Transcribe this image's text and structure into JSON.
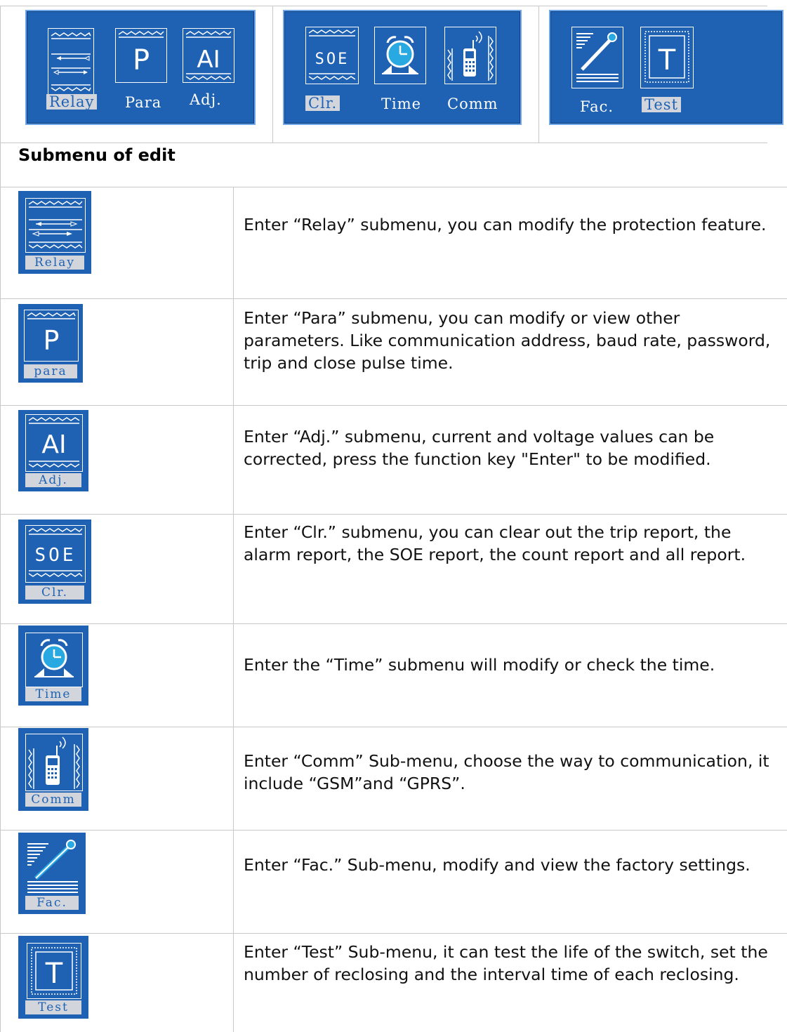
{
  "top_panels": [
    {
      "items": [
        {
          "label": "Relay",
          "selected": true
        },
        {
          "label": "Para",
          "selected": false
        },
        {
          "label": "Adj.",
          "selected": false
        }
      ]
    },
    {
      "items": [
        {
          "label": "Clr.",
          "selected": true
        },
        {
          "label": "Time",
          "selected": false
        },
        {
          "label": "Comm",
          "selected": false
        }
      ]
    },
    {
      "items": [
        {
          "label": "Fac.",
          "selected": false
        },
        {
          "label": "Test",
          "selected": true
        }
      ]
    }
  ],
  "icon_text": {
    "para": "P",
    "adj": "AI",
    "soe": "SOE",
    "test": "T"
  },
  "section_title": "Submenu of edit",
  "rows": [
    {
      "caption": "Relay",
      "icon": "relay-icon",
      "text": "Enter “Relay” submenu, you can modify the protection feature."
    },
    {
      "caption": "para",
      "icon": "para-icon",
      "text": "Enter “Para” submenu, you can modify or view other parameters. Like communication address, baud rate, password, trip and close pulse time."
    },
    {
      "caption": "Adj.",
      "icon": "adj-icon",
      "text": "Enter “Adj.” submenu, current and voltage values    can be corrected, press the function key \"Enter\" to be modified."
    },
    {
      "caption": "Clr.",
      "icon": "soe-icon",
      "text": "Enter “Clr.” submenu, you can clear out the trip report, the alarm report, the SOE report, the count report and all report."
    },
    {
      "caption": "Time",
      "icon": "alarm-clock-icon",
      "text": "Enter the “Time” submenu will modify or check the time."
    },
    {
      "caption": "Comm",
      "icon": "mobile-phone-icon",
      "text": "Enter “Comm” Sub-menu, choose the way to communication, it include “GSM”and “GPRS”."
    },
    {
      "caption": "Fac.",
      "icon": "factory-settings-icon",
      "text": "Enter “Fac.” Sub-menu, modify and view the factory settings."
    },
    {
      "caption": "Test",
      "icon": "test-icon",
      "text": "Enter “Test” Sub-menu, it can test the life of the switch, set the number of reclosing and the interval time of each reclosing."
    }
  ],
  "colors": {
    "panel_blue": "#1f62b3",
    "caption_gray": "#d2d6dc",
    "grid": "#c8c8c8"
  }
}
